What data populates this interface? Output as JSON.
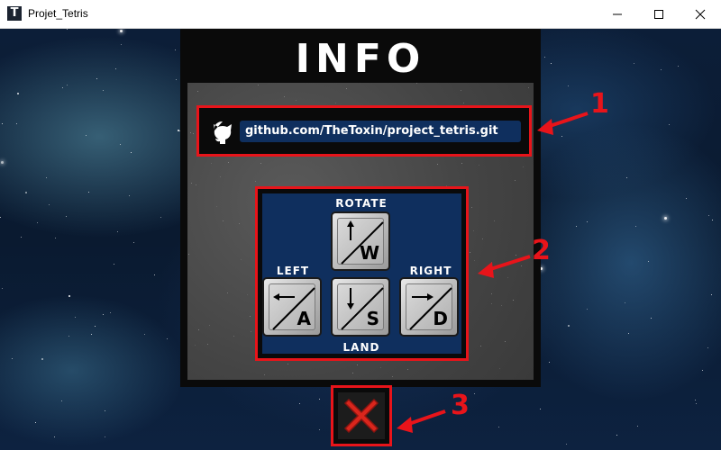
{
  "window": {
    "title": "Projet_Tetris",
    "app_icon_letter": "T",
    "controls": [
      "minimize-icon",
      "maximize-icon",
      "close-icon"
    ]
  },
  "panel": {
    "title": "INFO",
    "github_link": "github.com/TheToxin/project_tetris.git"
  },
  "controls": {
    "rotate_label": "ROTATE",
    "left_label": "LEFT",
    "right_label": "RIGHT",
    "land_label": "LAND",
    "keys": {
      "w": "W",
      "a": "A",
      "s": "S",
      "d": "D"
    }
  },
  "annotations": {
    "one": "1",
    "two": "2",
    "three": "3"
  },
  "colors": {
    "highlight": "#e8141a",
    "panel_blue": "#0f2f5e",
    "close_x": "#d9261c"
  }
}
